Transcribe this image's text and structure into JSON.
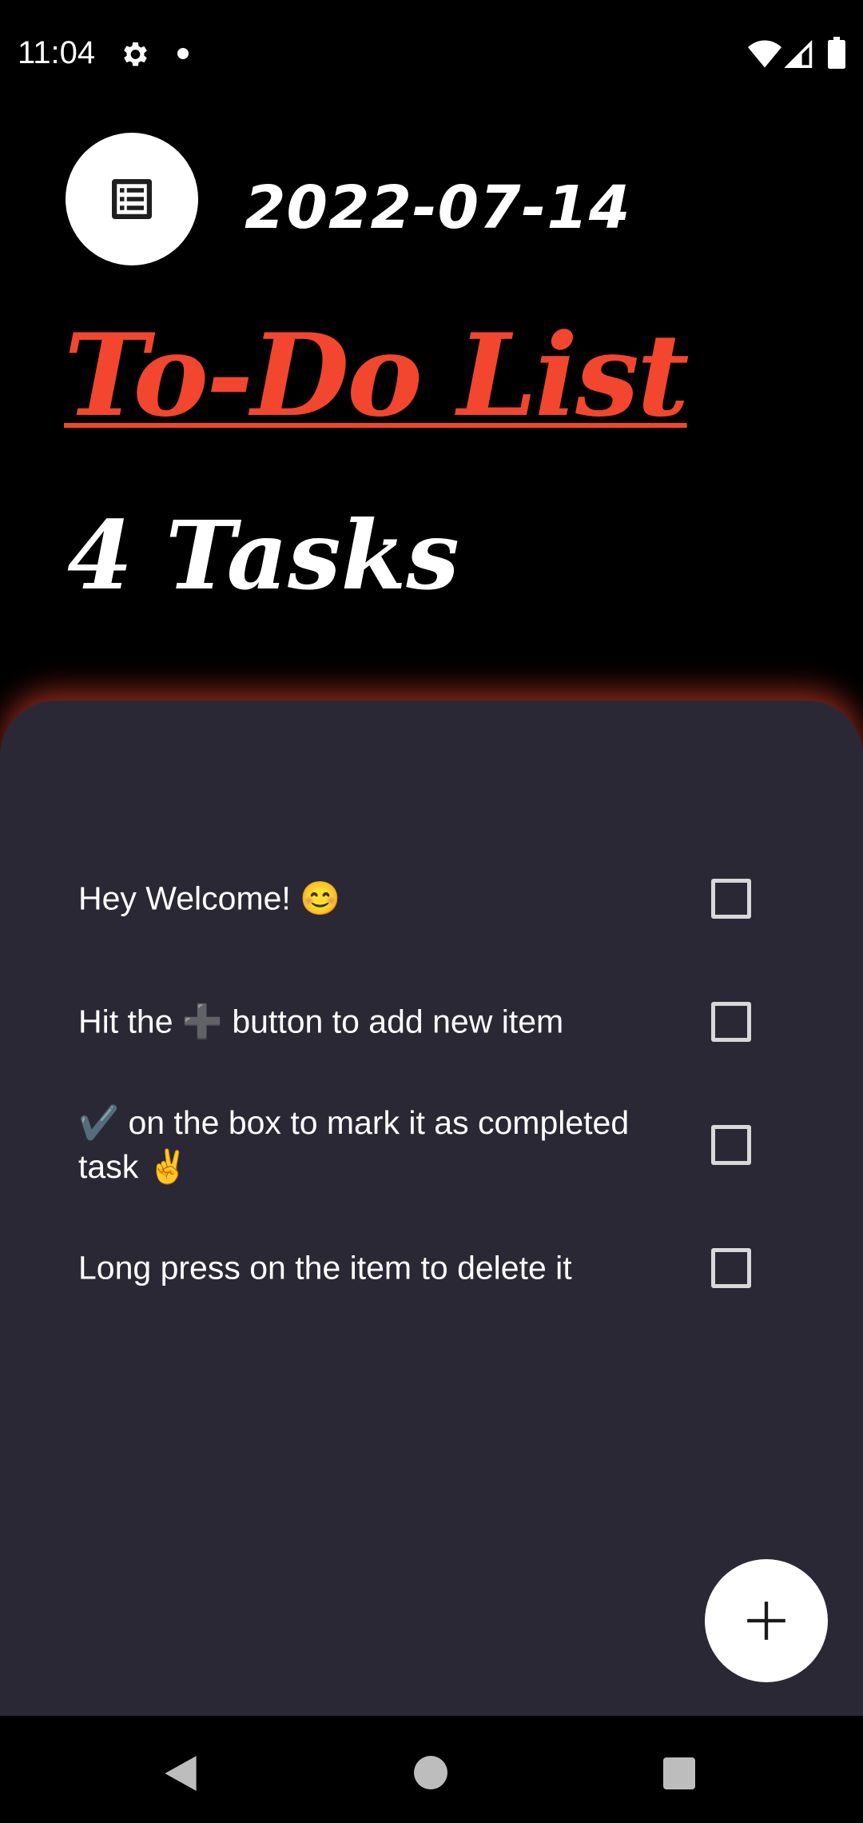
{
  "status_bar": {
    "time": "11:04",
    "icons": [
      "gear-icon",
      "notification-dot",
      "wifi-icon",
      "signal-icon",
      "battery-icon"
    ]
  },
  "header": {
    "icon": "list-icon",
    "date": "2022-07-14",
    "title": "To-Do List",
    "task_count": "4 Tasks"
  },
  "tasks": [
    {
      "text": "Hey Welcome! 😊",
      "checked": false
    },
    {
      "text": "Hit the ➕ button to add new item",
      "checked": false
    },
    {
      "text": "✔️ on the box to mark it as completed task ✌️",
      "checked": false
    },
    {
      "text": "Long press on the item to delete it",
      "checked": false
    }
  ],
  "fab": {
    "icon": "plus-icon"
  },
  "nav_bar": {
    "icons": [
      "back-icon",
      "home-icon",
      "recents-icon"
    ]
  },
  "colors": {
    "background": "#000000",
    "panel": "#2b2836",
    "accent": "#f2462e",
    "text": "#ffffff"
  }
}
